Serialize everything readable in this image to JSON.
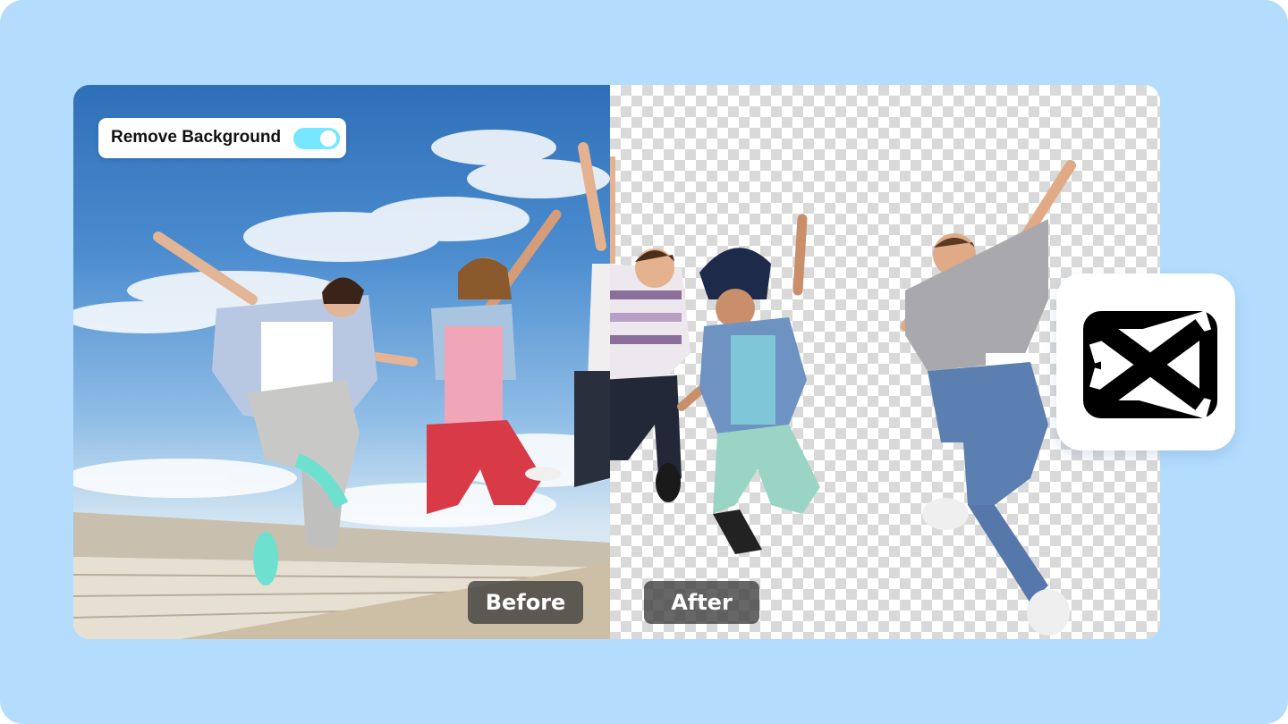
{
  "toggle": {
    "label": "Remove Background",
    "state": "on"
  },
  "labels": {
    "before": "Before",
    "after": "After"
  },
  "brand": {
    "logo_icon": "capcut-logo-icon",
    "accent": "#77e7ff",
    "background": "#b3dcfd"
  }
}
